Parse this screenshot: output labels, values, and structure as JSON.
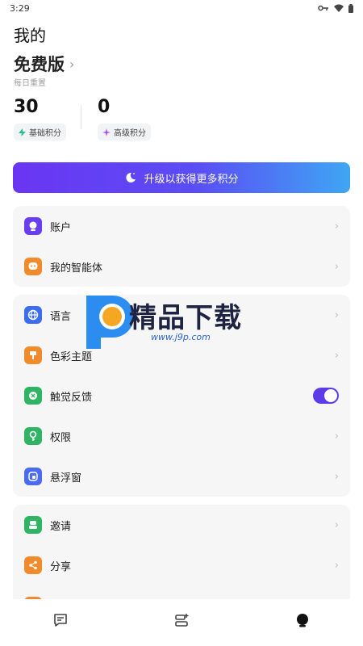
{
  "status_bar": {
    "time": "3:29"
  },
  "header": {
    "title": "我的"
  },
  "plan": {
    "name": "免费版",
    "subtitle": "每日重置"
  },
  "credits": {
    "basic": {
      "value": "30",
      "label": "基础积分"
    },
    "advanced": {
      "value": "0",
      "label": "高级积分"
    }
  },
  "upgrade": {
    "label": "升级以获得更多积分"
  },
  "groups": {
    "g1": [
      {
        "label": "账户",
        "icon": "account-icon",
        "color": "#6a3df0"
      },
      {
        "label": "我的智能体",
        "icon": "agent-icon",
        "color": "#f08a2a"
      }
    ],
    "g2": [
      {
        "label": "语言",
        "icon": "globe-icon",
        "color": "#3a6df0"
      },
      {
        "label": "色彩主题",
        "icon": "palette-icon",
        "color": "#f08a2a"
      },
      {
        "label": "触觉反馈",
        "icon": "vibration-icon",
        "color": "#2fb463",
        "toggle": true
      },
      {
        "label": "权限",
        "icon": "key-icon",
        "color": "#2fb463"
      },
      {
        "label": "悬浮窗",
        "icon": "floating-window-icon",
        "color": "#4a6bf0"
      }
    ],
    "g3": [
      {
        "label": "邀请",
        "icon": "invite-icon",
        "color": "#2fb463"
      },
      {
        "label": "分享",
        "icon": "share-icon",
        "color": "#f08a2a"
      }
    ]
  },
  "watermark": {
    "title": "精品下载",
    "url": "www.j9p.com"
  },
  "colors": {
    "accent": "#5b3ce8"
  }
}
